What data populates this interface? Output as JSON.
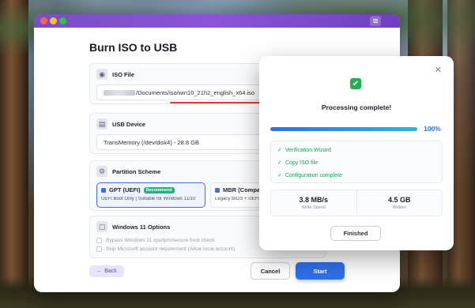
{
  "app": {
    "title": "Burn ISO to USB"
  },
  "iso": {
    "title": "ISO File",
    "path_suffix": "/Documents/iso/win10_21h2_english_x64.iso"
  },
  "usb": {
    "title": "USB Device",
    "device": "TransMemory (/dev/disk4) - 28.8 GB"
  },
  "partition": {
    "title": "Partition Scheme",
    "gpt_name": "GPT (UEFI)",
    "gpt_badge": "Recommend",
    "gpt_desc": "UEFI Boot Only | Suitable for Windows 11/10",
    "mbr_name": "MBR (Compat",
    "mbr_desc": "Legacy BIOS + UEFI"
  },
  "win11": {
    "title": "Windows 11 Options",
    "opt1": "Bypass Windows 11 cpu/tpm/secure boot check",
    "opt2": "Skip Microsoft account requirement (Allow local account)"
  },
  "buttons": {
    "back": "Back",
    "cancel": "Cancel",
    "start": "Start"
  },
  "dialog": {
    "title": "Processing complete!",
    "progress_percent": 100,
    "progress_label": "100%",
    "steps": [
      "Verification Wizard",
      "Copy ISO file",
      "Configuration complete"
    ],
    "speed_value": "3.8 MB/s",
    "speed_label": "Write Speed",
    "written_value": "4.5 GB",
    "written_label": "Written",
    "finished": "Finished"
  }
}
